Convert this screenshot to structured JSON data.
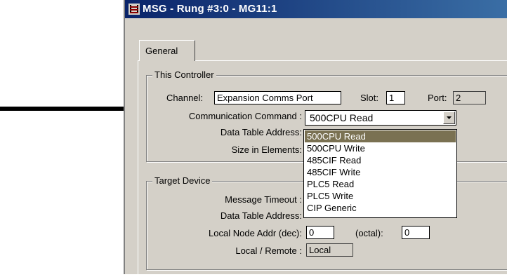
{
  "window": {
    "title": "MSG - Rung #3:0 - MG11:1",
    "title_icon": "ladder-icon",
    "accent": "#0a246a"
  },
  "tabs": [
    {
      "label": "General",
      "active": true
    }
  ],
  "this_controller": {
    "group_label": "This Controller",
    "channel_label": "Channel:",
    "channel_value": "Expansion Comms Port",
    "slot_label": "Slot:",
    "slot_value": "1",
    "port_label": "Port:",
    "port_value": "2",
    "comm_command_label": "Communication Command :",
    "comm_command_value": "500CPU Read",
    "data_table_address_label": "Data Table Address:",
    "size_in_elements_label": "Size in Elements:"
  },
  "comm_command_options": [
    {
      "label": "500CPU Read",
      "selected": true
    },
    {
      "label": "500CPU Write",
      "selected": false
    },
    {
      "label": "485CIF Read",
      "selected": false
    },
    {
      "label": "485CIF Write",
      "selected": false
    },
    {
      "label": "PLC5 Read",
      "selected": false
    },
    {
      "label": "PLC5 Write",
      "selected": false
    },
    {
      "label": "CIP Generic",
      "selected": false
    }
  ],
  "target_device": {
    "group_label": "Target Device",
    "message_timeout_label": "Message Timeout :",
    "data_table_address_label": "Data Table Address:",
    "local_node_addr_label": "Local Node Addr (dec):",
    "local_node_addr_value": "0",
    "octal_label": "(octal):",
    "octal_value": "0",
    "local_remote_label": "Local / Remote :",
    "local_remote_value": "Local"
  },
  "annotation": {
    "pointer": "arrow-right-icon"
  },
  "colors": {
    "selection": "#7a7152",
    "dialog": "#d4d0c8"
  }
}
